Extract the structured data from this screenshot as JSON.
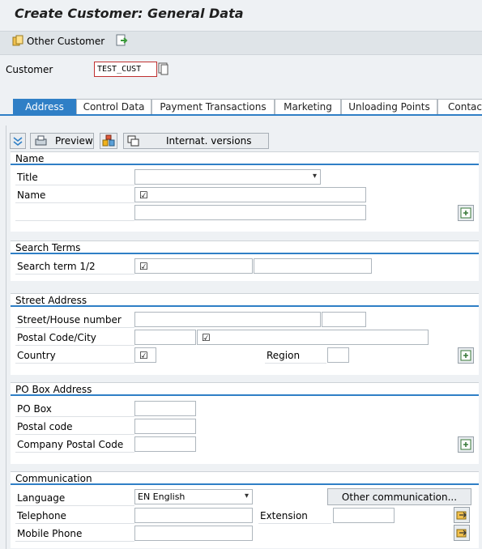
{
  "window": {
    "title": "Create Customer: General Data"
  },
  "toolbar": {
    "other_customer": "Other Customer"
  },
  "customer": {
    "label": "Customer",
    "value": "TEST_CUST"
  },
  "tabs": [
    "Address",
    "Control Data",
    "Payment Transactions",
    "Marketing",
    "Unloading Points",
    "Contact"
  ],
  "actions": {
    "preview": "Preview",
    "internat_versions": "Internat. versions"
  },
  "name_section": {
    "title": "Name",
    "title_label": "Title",
    "title_value": "",
    "name_label": "Name",
    "name_value": "☑"
  },
  "search_terms": {
    "title": "Search Terms",
    "label": "Search term 1/2",
    "value1": "☑",
    "value2": ""
  },
  "street_address": {
    "title": "Street Address",
    "street_label": "Street/House number",
    "postal_label": "Postal Code/City",
    "country_label": "Country",
    "country_value": "☑",
    "region_label": "Region",
    "city_value": "☑"
  },
  "po_box": {
    "title": "PO Box Address",
    "po_box_label": "PO Box",
    "postal_code_label": "Postal code",
    "company_postal_label": "Company Postal Code"
  },
  "communication": {
    "title": "Communication",
    "language_label": "Language",
    "language_value": "EN English",
    "other_comm": "Other communication...",
    "telephone_label": "Telephone",
    "extension_label": "Extension",
    "mobile_label": "Mobile Phone"
  },
  "colors": {
    "accent": "#2f7fc6",
    "required_border": "#c03030"
  }
}
